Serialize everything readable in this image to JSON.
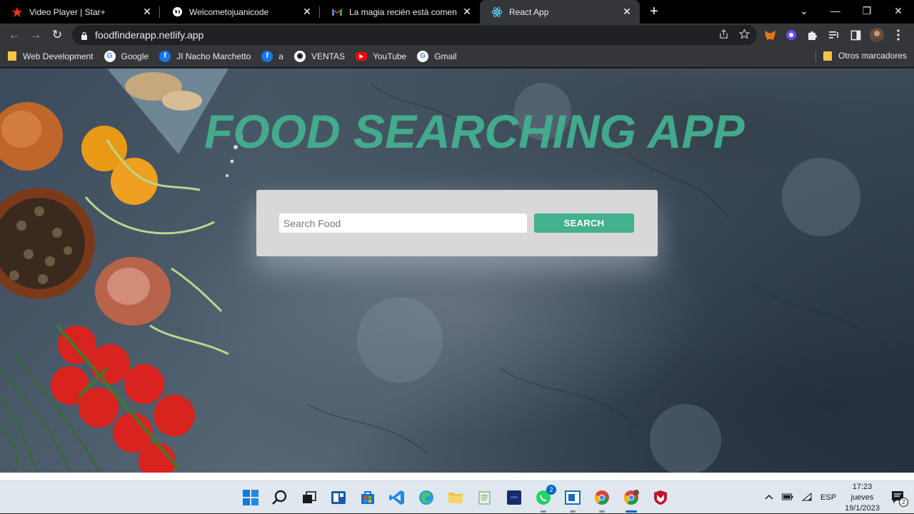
{
  "browser": {
    "tabs": [
      {
        "title": "Video Player | Star+",
        "favicon": "star-plus-icon",
        "close": "✕"
      },
      {
        "title": "Welcometojuanicode",
        "favicon": "globe-icon",
        "close": "✕"
      },
      {
        "title": "La magia recién está comenzando",
        "favicon": "gmail-icon",
        "close": "✕"
      },
      {
        "title": "React App",
        "favicon": "react-icon",
        "close": "✕",
        "active": true
      }
    ],
    "new_tab": "+",
    "window_controls": {
      "tab_search": "⌄",
      "minimize": "—",
      "restore": "❐",
      "close": "✕"
    },
    "nav": {
      "back": "←",
      "forward": "→",
      "reload": "↻"
    },
    "url": "foodfinderapp.netlify.app",
    "bookmarks": [
      {
        "label": "Web Development",
        "icon": "folder-icon"
      },
      {
        "label": "Google",
        "icon": "google-icon"
      },
      {
        "label": "JI Nacho Marchetto",
        "icon": "facebook-icon"
      },
      {
        "label": "a",
        "icon": "facebook-icon"
      },
      {
        "label": "VENTAS",
        "icon": "globe-icon"
      },
      {
        "label": "YouTube",
        "icon": "youtube-icon"
      },
      {
        "label": "Gmail",
        "icon": "google-icon"
      }
    ],
    "other_bookmarks": "Otros marcadores"
  },
  "page": {
    "title": "FOOD SEARCHING APP",
    "search": {
      "placeholder": "Search Food",
      "value": "",
      "button_label": "SEARCH"
    },
    "colors": {
      "accent": "#43b08f",
      "card": "#d8d8d8"
    }
  },
  "taskbar": {
    "whatsapp_badge": "2",
    "language": "ESP",
    "time": "17:23",
    "day": "jueves",
    "date": "19/1/2023",
    "notifications": "2"
  }
}
